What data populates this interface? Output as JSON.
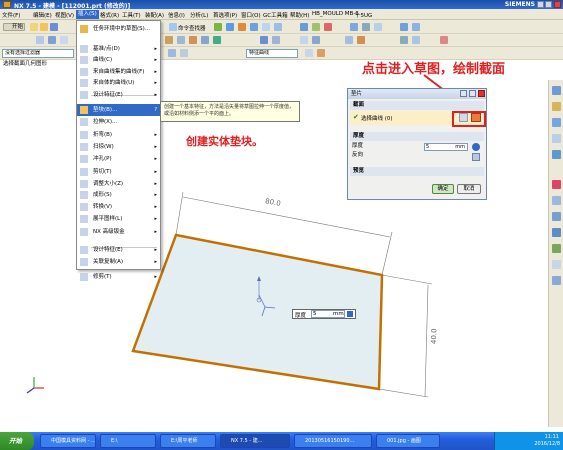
{
  "title_bar": {
    "title": "NX 7.5 - 建模 - [112001.prt (修改的)]",
    "brand": "SIEMENS"
  },
  "menu": {
    "items": [
      "文件(F)",
      "编辑(E)",
      "视图(V)",
      "插入(S)",
      "格式(R)",
      "工具(T)",
      "装配(A)",
      "信息(I)",
      "分析(L)",
      "首选项(P)",
      "窗口(O)",
      "GC工具箱",
      "帮助(H)",
      "HB_MOULD MB-6",
      "十5UG"
    ],
    "active_index": 3
  },
  "toolbar": {
    "start_label": "开始",
    "task_env_label": "任务环境中的草图(S)...",
    "command_finder": "命令查找器",
    "filter_value": "没有选择过滤器",
    "feature_dropdown": "特征曲线",
    "face_dropdown": "面"
  },
  "cue_line": "选择截面几何图形",
  "insert_menu": {
    "items": [
      {
        "label": "任务环境中的草图(S)...",
        "submenu": false
      },
      {
        "label": "基准/点(D)",
        "submenu": true
      },
      {
        "label": "曲线(C)",
        "submenu": true
      },
      {
        "label": "来自曲线集的曲线(F)",
        "submenu": true
      },
      {
        "label": "来自体的曲线(U)",
        "submenu": true
      },
      {
        "label": "设计特征(E)",
        "submenu": true
      },
      {
        "label": "拉伸(X)...",
        "submenu": false
      },
      {
        "label": "折弯(B)",
        "submenu": true
      },
      {
        "label": "扫掠(W)",
        "submenu": true
      },
      {
        "label": "冲孔(P)",
        "submenu": true
      },
      {
        "label": "剪切(T)",
        "submenu": true
      },
      {
        "label": "调整大小(Z)",
        "submenu": true
      },
      {
        "label": "成形(S)",
        "submenu": true
      },
      {
        "label": "转换(V)",
        "submenu": true
      },
      {
        "label": "展平图样(L)",
        "submenu": true
      },
      {
        "label": "NX 高级钣金",
        "submenu": true
      },
      {
        "label": "设计特征(E)",
        "submenu": true
      },
      {
        "label": "关联复制(A)",
        "submenu": true
      },
      {
        "label": "修剪(T)",
        "submenu": true
      }
    ],
    "highlighted_label": "垫块(B)...",
    "highlight_shortcut": "?"
  },
  "tooltip": "创建一个基本特征，方法是沿矢量将草图拉伸一个厚度值，或沿如材料侧添一个平的面上。",
  "dialog": {
    "title": "垫片",
    "section_section": "截面",
    "select_curve": "选择曲线 (0)",
    "section_thickness": "厚度",
    "thickness_label": "厚度",
    "thickness_value": "5",
    "thickness_unit": "mm",
    "reverse_label": "反向",
    "section_preview": "预览",
    "ok": "确定",
    "cancel": "取消"
  },
  "annotations": {
    "sketch_hint": "点击进入草图，绘制截面",
    "create_pad": "创建实体垫块。"
  },
  "canvas": {
    "dim_width": "80.0",
    "dim_height": "40.0",
    "dim_input_label": "厚度",
    "dim_input_value": "5",
    "dim_input_unit": "mm"
  },
  "taskbar": {
    "start": "开始",
    "tasks": [
      "中国模具资料网 - ...",
      "E:\\",
      "E:\\周平老师",
      "NX 7.5 - 建...",
      "20130516150190...",
      "001.jpg - 画图"
    ],
    "time": "11:11",
    "date": "2016/12/8"
  },
  "colors": {
    "highlight": "#3169c6",
    "annotation_red": "#e02020",
    "plate_edge": "#c47000",
    "plate_fill": "#e2eef2"
  }
}
